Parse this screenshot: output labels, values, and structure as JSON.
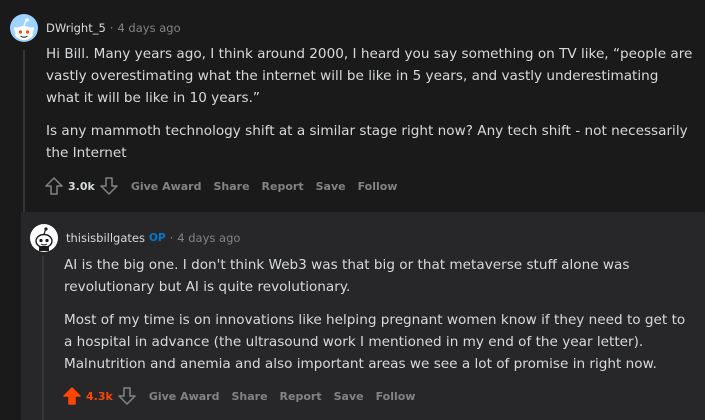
{
  "comment1": {
    "username": "DWright_5",
    "separator": "·",
    "time": "4 days ago",
    "paragraphs": [
      "Hi Bill. Many years ago, I think around 2000, I heard you say something on TV like, “people are vastly overestimating what the internet will be like in 5 years, and vastly underestimating what it will be like in 10 years.”",
      "Is any mammoth technology shift at a similar stage right now? Any tech shift - not necessarily the Internet"
    ],
    "score": "3.0k",
    "actions": [
      "Give Award",
      "Share",
      "Report",
      "Save",
      "Follow"
    ],
    "avatar": "snoo-avatar-blue"
  },
  "comment2": {
    "username": "thisisbillgates",
    "op_badge": "OP",
    "separator": "·",
    "time": "4 days ago",
    "paragraphs": [
      "AI is the big one. I don't think Web3 was that big or that metaverse stuff alone was revolutionary but AI is quite revolutionary.",
      "Most of my time is on innovations like helping pregnant women know if they need to get to a hospital in advance (the ultrasound work I mentioned in my end of the year letter). Malnutrition and anemia and also important areas we see a lot of promise in right now."
    ],
    "score": "4.3k",
    "upvoted": true,
    "actions": [
      "Give Award",
      "Share",
      "Report",
      "Save",
      "Follow"
    ],
    "avatar": "snoo-avatar-white"
  },
  "colors": {
    "background": "#1a1a1b",
    "nested_background": "#272729",
    "text": "#d7dadc",
    "muted": "#818384",
    "op_blue": "#0079d3",
    "upvote_orange": "#ff4500"
  }
}
